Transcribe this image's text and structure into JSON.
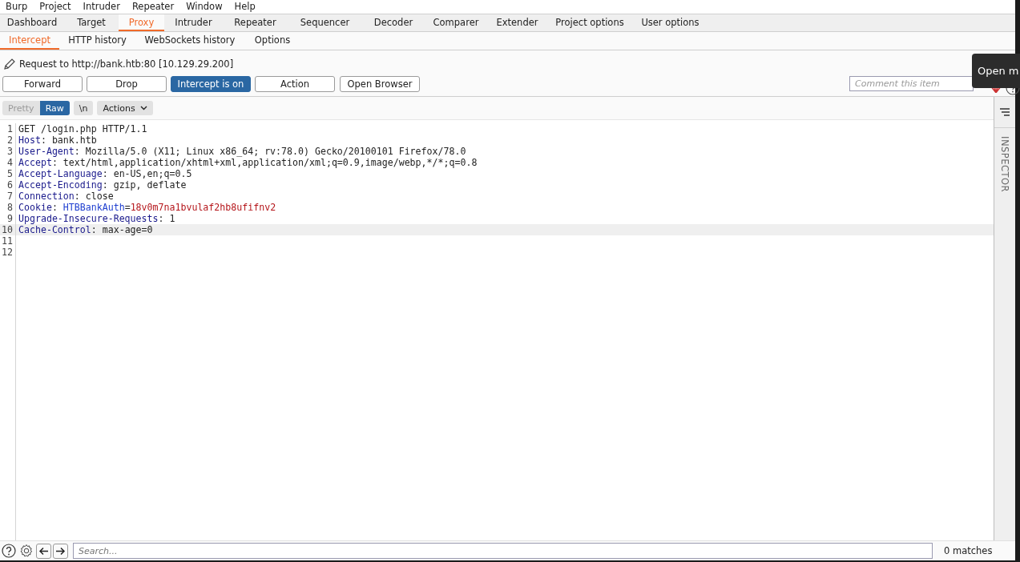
{
  "menu_bar": [
    "Burp",
    "Project",
    "Intruder",
    "Repeater",
    "Window",
    "Help"
  ],
  "tabs": [
    {
      "label": "Dashboard",
      "selected": false
    },
    {
      "label": "Target",
      "selected": false
    },
    {
      "label": "Proxy",
      "selected": true
    },
    {
      "label": "Intruder",
      "selected": false
    },
    {
      "label": "Repeater",
      "selected": false
    },
    {
      "label": "Sequencer",
      "selected": false
    },
    {
      "label": "Decoder",
      "selected": false
    },
    {
      "label": "Comparer",
      "selected": false
    },
    {
      "label": "Extender",
      "selected": false
    },
    {
      "label": "Project options",
      "selected": false
    },
    {
      "label": "User options",
      "selected": false
    }
  ],
  "sub_tabs": [
    {
      "label": "Intercept",
      "selected": true
    },
    {
      "label": "HTTP history",
      "selected": false
    },
    {
      "label": "WebSockets history",
      "selected": false
    },
    {
      "label": "Options",
      "selected": false
    }
  ],
  "request_info": "Request to http://bank.htb:80  [10.129.29.200]",
  "buttons": [
    {
      "label": "Forward",
      "on": false
    },
    {
      "label": "Drop",
      "on": false
    },
    {
      "label": "Intercept is on",
      "on": true
    },
    {
      "label": "Action",
      "on": false
    },
    {
      "label": "Open Browser",
      "on": false
    }
  ],
  "comment": {
    "placeholder": "Comment this item"
  },
  "tooltip": "Open m",
  "view_modes": [
    {
      "label": "Pretty",
      "selected": false
    },
    {
      "label": "Raw",
      "selected": true
    }
  ],
  "newline_button": "\\n",
  "actions_menu": "Actions",
  "editor_lines": [
    {
      "number": "1",
      "highlighted": false,
      "segments": [
        {
          "kind": "plain",
          "text": "GET /login.php HTTP/1.1"
        }
      ]
    },
    {
      "number": "2",
      "highlighted": false,
      "segments": [
        {
          "kind": "header",
          "text": "Host"
        },
        {
          "kind": "plain",
          "text": ": bank.htb"
        }
      ]
    },
    {
      "number": "3",
      "highlighted": false,
      "segments": [
        {
          "kind": "header",
          "text": "User-Agent"
        },
        {
          "kind": "plain",
          "text": ": Mozilla/5.0 (X11; Linux x86_64; rv:78.0) Gecko/20100101 Firefox/78.0"
        }
      ]
    },
    {
      "number": "4",
      "highlighted": false,
      "segments": [
        {
          "kind": "header",
          "text": "Accept"
        },
        {
          "kind": "plain",
          "text": ": text/html,application/xhtml+xml,application/xml;q=0.9,image/webp,*/*;q=0.8"
        }
      ]
    },
    {
      "number": "5",
      "highlighted": false,
      "segments": [
        {
          "kind": "header",
          "text": "Accept-Language"
        },
        {
          "kind": "plain",
          "text": ": en-US,en;q=0.5"
        }
      ]
    },
    {
      "number": "6",
      "highlighted": false,
      "segments": [
        {
          "kind": "header",
          "text": "Accept-Encoding"
        },
        {
          "kind": "plain",
          "text": ": gzip, deflate"
        }
      ]
    },
    {
      "number": "7",
      "highlighted": false,
      "segments": [
        {
          "kind": "header",
          "text": "Connection"
        },
        {
          "kind": "plain",
          "text": ": close"
        }
      ]
    },
    {
      "number": "8",
      "highlighted": false,
      "segments": [
        {
          "kind": "header",
          "text": "Cookie"
        },
        {
          "kind": "plain",
          "text": ": "
        },
        {
          "kind": "param-name",
          "text": "HTBBankAuth"
        },
        {
          "kind": "plain",
          "text": "="
        },
        {
          "kind": "param-value",
          "text": "18v0m7na1bvulaf2hb8ufifnv2"
        }
      ]
    },
    {
      "number": "9",
      "highlighted": false,
      "segments": [
        {
          "kind": "header",
          "text": "Upgrade-Insecure-Requests"
        },
        {
          "kind": "plain",
          "text": ": 1"
        }
      ]
    },
    {
      "number": "10",
      "highlighted": true,
      "segments": [
        {
          "kind": "header",
          "text": "Cache-Control"
        },
        {
          "kind": "plain",
          "text": ": max-age=0"
        }
      ]
    },
    {
      "number": "11",
      "highlighted": false
    },
    {
      "number": "12",
      "highlighted": false
    }
  ],
  "inspector_label": "INSPECTOR",
  "search": {
    "placeholder": "Search..."
  },
  "match_count": "0 matches"
}
